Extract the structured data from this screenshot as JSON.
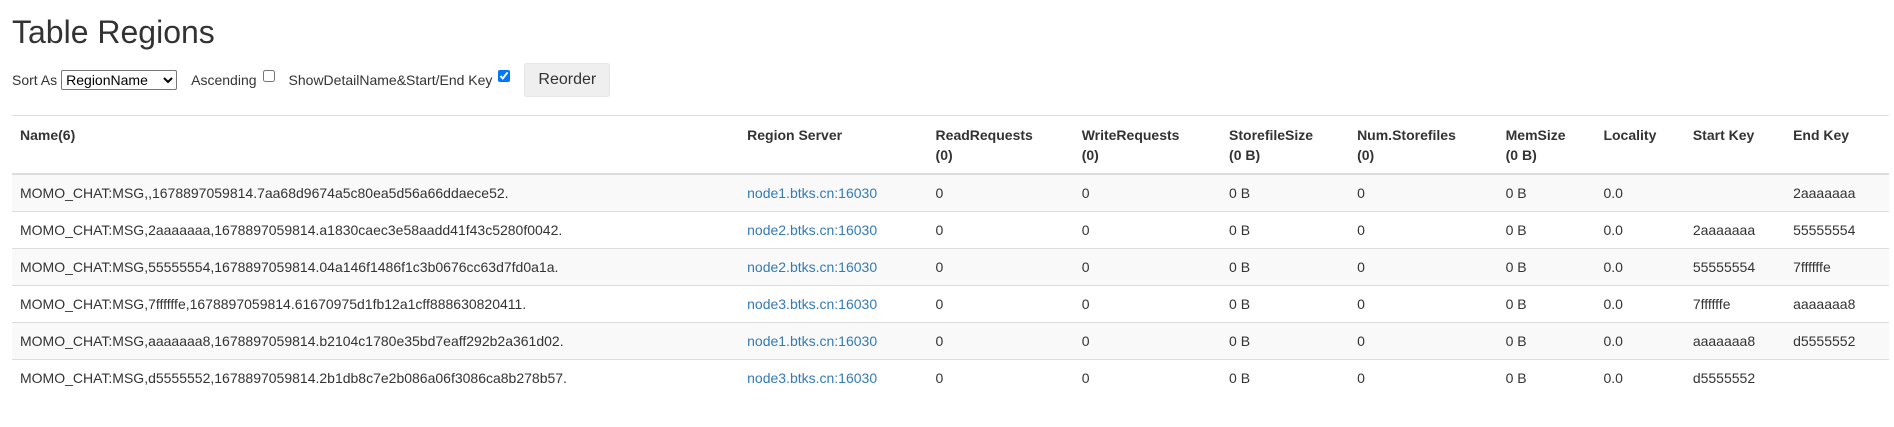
{
  "page": {
    "title": "Table Regions"
  },
  "controls": {
    "sort_as_label": "Sort As",
    "sort_selected": "RegionName",
    "ascending_label": "Ascending",
    "ascending_checked": false,
    "show_detail_label": "ShowDetailName&Start/End Key",
    "show_detail_checked": true,
    "reorder_label": "Reorder"
  },
  "table": {
    "headers": [
      {
        "label": "Name(6)",
        "sub": ""
      },
      {
        "label": "Region Server",
        "sub": ""
      },
      {
        "label": "ReadRequests",
        "sub": "(0)"
      },
      {
        "label": "WriteRequests",
        "sub": "(0)"
      },
      {
        "label": "StorefileSize",
        "sub": "(0 B)"
      },
      {
        "label": "Num.Storefiles",
        "sub": "(0)"
      },
      {
        "label": "MemSize",
        "sub": "(0 B)"
      },
      {
        "label": "Locality",
        "sub": ""
      },
      {
        "label": "Start Key",
        "sub": ""
      },
      {
        "label": "End Key",
        "sub": ""
      }
    ],
    "rows": [
      {
        "name": "MOMO_CHAT:MSG,,1678897059814.7aa68d9674a5c80ea5d56a66ddaece52.",
        "server": "node1.btks.cn:16030",
        "read": "0",
        "write": "0",
        "storefile_size": "0 B",
        "num_storefiles": "0",
        "memsize": "0 B",
        "locality": "0.0",
        "start_key": "",
        "end_key": "2aaaaaaa"
      },
      {
        "name": "MOMO_CHAT:MSG,2aaaaaaa,1678897059814.a1830caec3e58aadd41f43c5280f0042.",
        "server": "node2.btks.cn:16030",
        "read": "0",
        "write": "0",
        "storefile_size": "0 B",
        "num_storefiles": "0",
        "memsize": "0 B",
        "locality": "0.0",
        "start_key": "2aaaaaaa",
        "end_key": "55555554"
      },
      {
        "name": "MOMO_CHAT:MSG,55555554,1678897059814.04a146f1486f1c3b0676cc63d7fd0a1a.",
        "server": "node2.btks.cn:16030",
        "read": "0",
        "write": "0",
        "storefile_size": "0 B",
        "num_storefiles": "0",
        "memsize": "0 B",
        "locality": "0.0",
        "start_key": "55555554",
        "end_key": "7ffffffe"
      },
      {
        "name": "MOMO_CHAT:MSG,7ffffffe,1678897059814.61670975d1fb12a1cff888630820411.",
        "server": "node3.btks.cn:16030",
        "read": "0",
        "write": "0",
        "storefile_size": "0 B",
        "num_storefiles": "0",
        "memsize": "0 B",
        "locality": "0.0",
        "start_key": "7ffffffe",
        "end_key": "aaaaaaa8"
      },
      {
        "name": "MOMO_CHAT:MSG,aaaaaaa8,1678897059814.b2104c1780e35bd7eaff292b2a361d02.",
        "server": "node1.btks.cn:16030",
        "read": "0",
        "write": "0",
        "storefile_size": "0 B",
        "num_storefiles": "0",
        "memsize": "0 B",
        "locality": "0.0",
        "start_key": "aaaaaaa8",
        "end_key": "d5555552"
      },
      {
        "name": "MOMO_CHAT:MSG,d5555552,1678897059814.2b1db8c7e2b086a06f3086ca8b278b57.",
        "server": "node3.btks.cn:16030",
        "read": "0",
        "write": "0",
        "storefile_size": "0 B",
        "num_storefiles": "0",
        "memsize": "0 B",
        "locality": "0.0",
        "start_key": "d5555552",
        "end_key": ""
      }
    ]
  },
  "colors": {
    "link": "#337ab7",
    "row_stripe": "#f9f9f9",
    "border": "#dddddd"
  }
}
